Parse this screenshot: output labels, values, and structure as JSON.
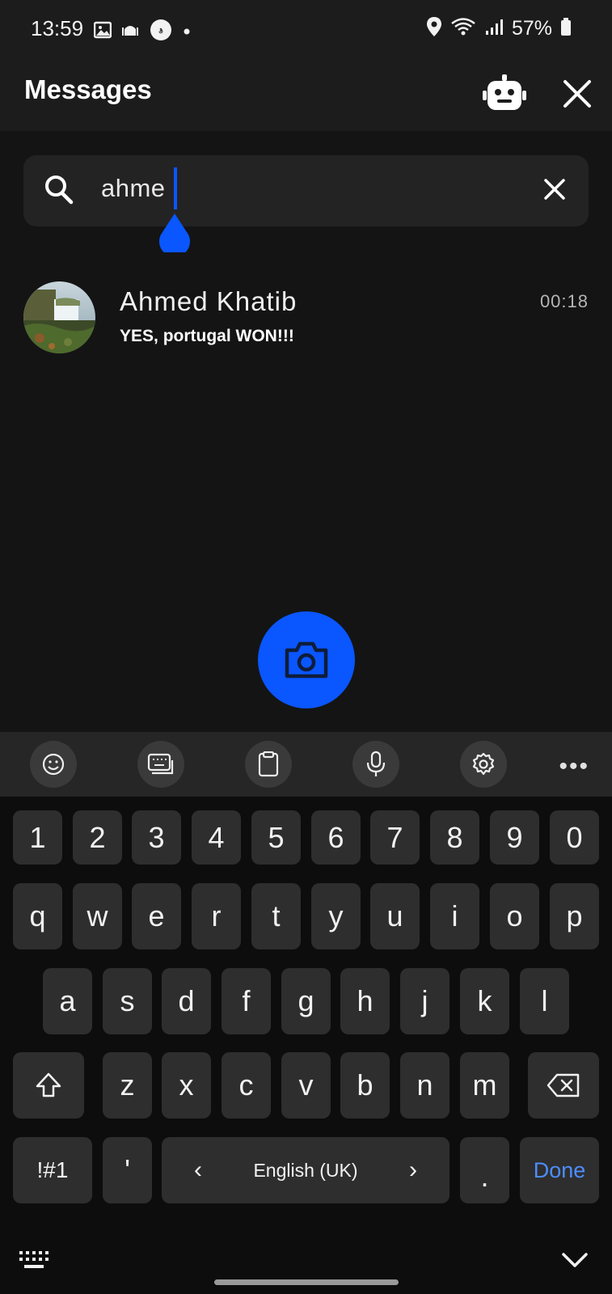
{
  "status_bar": {
    "time": "13:59",
    "battery_percent": "57%",
    "icons_left": [
      "gallery-icon",
      "mosque-icon",
      "app-badge-icon",
      "dot-icon"
    ],
    "icons_right": [
      "location-icon",
      "wifi-icon",
      "signal-icon",
      "battery-icon"
    ]
  },
  "app_bar": {
    "title": "Messages",
    "robot_button": "robot-icon",
    "close_button": "close-icon"
  },
  "search": {
    "query": "ahme"
  },
  "conversations": [
    {
      "name": "Ahmed Khatib",
      "time": "00:18",
      "preview": "YES, portugal WON!!!"
    }
  ],
  "fab": {
    "icon": "camera-icon"
  },
  "keyboard_toolbar": {
    "tools": [
      "emoji-icon",
      "keyboard-mode-icon",
      "clipboard-icon",
      "microphone-icon",
      "settings-icon"
    ],
    "more": "•••"
  },
  "keyboard": {
    "row_numbers": [
      "1",
      "2",
      "3",
      "4",
      "5",
      "6",
      "7",
      "8",
      "9",
      "0"
    ],
    "row_1": [
      "q",
      "w",
      "e",
      "r",
      "t",
      "y",
      "u",
      "i",
      "o",
      "p"
    ],
    "row_2": [
      "a",
      "s",
      "d",
      "f",
      "g",
      "h",
      "j",
      "k",
      "l"
    ],
    "row_3": [
      "z",
      "x",
      "c",
      "v",
      "b",
      "n",
      "m"
    ],
    "symbols_key": "!#1",
    "apostrophe_key": "'",
    "space_label": "English (UK)",
    "left_arrow": "‹",
    "right_arrow": "›",
    "period_key": ".",
    "done_key": "Done",
    "accent_color": "#0a56ff"
  }
}
